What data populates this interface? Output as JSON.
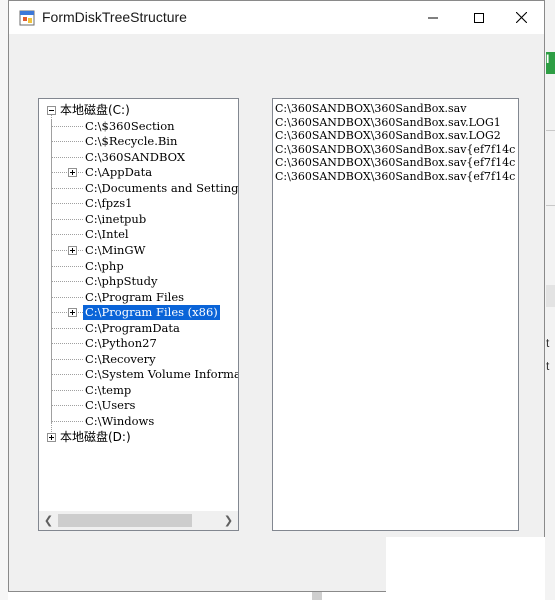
{
  "window": {
    "title": "FormDiskTreeStructure"
  },
  "caption_buttons": {
    "minimize": "minimize",
    "maximize": "maximize",
    "close": "close"
  },
  "tree": {
    "drives": [
      {
        "label": "本地磁盘(C:)",
        "expanded": true,
        "children": [
          {
            "label": "C:\\$360Section",
            "expandable": false
          },
          {
            "label": "C:\\$Recycle.Bin",
            "expandable": false
          },
          {
            "label": "C:\\360SANDBOX",
            "expandable": false
          },
          {
            "label": "C:\\AppData",
            "expandable": true
          },
          {
            "label": "C:\\Documents and Settings",
            "expandable": false
          },
          {
            "label": "C:\\fpzs1",
            "expandable": false
          },
          {
            "label": "C:\\inetpub",
            "expandable": false
          },
          {
            "label": "C:\\Intel",
            "expandable": false
          },
          {
            "label": "C:\\MinGW",
            "expandable": true
          },
          {
            "label": "C:\\php",
            "expandable": false
          },
          {
            "label": "C:\\phpStudy",
            "expandable": false
          },
          {
            "label": "C:\\Program Files",
            "expandable": false
          },
          {
            "label": "C:\\Program Files (x86)",
            "expandable": true,
            "selected": true
          },
          {
            "label": "C:\\ProgramData",
            "expandable": false
          },
          {
            "label": "C:\\Python27",
            "expandable": false
          },
          {
            "label": "C:\\Recovery",
            "expandable": false
          },
          {
            "label": "C:\\System Volume Information",
            "expandable": false
          },
          {
            "label": "C:\\temp",
            "expandable": false
          },
          {
            "label": "C:\\Users",
            "expandable": false
          },
          {
            "label": "C:\\Windows",
            "expandable": false
          }
        ]
      },
      {
        "label": "本地磁盘(D:)",
        "expanded": false,
        "children": []
      }
    ]
  },
  "file_list": {
    "items": [
      "C:\\360SANDBOX\\360SandBox.sav",
      "C:\\360SANDBOX\\360SandBox.sav.LOG1",
      "C:\\360SANDBOX\\360SandBox.sav.LOG2",
      "C:\\360SANDBOX\\360SandBox.sav{ef7f14c",
      "C:\\360SANDBOX\\360SandBox.sav{ef7f14c",
      "C:\\360SANDBOX\\360SandBox.sav{ef7f14c"
    ]
  },
  "background": {
    "tab_glyph": "I",
    "glyph_a": "t",
    "glyph_b": "t"
  },
  "colors": {
    "selection": "#0a64d8",
    "window_bg": "#f0f0f0",
    "title_bg": "#ffffff"
  }
}
